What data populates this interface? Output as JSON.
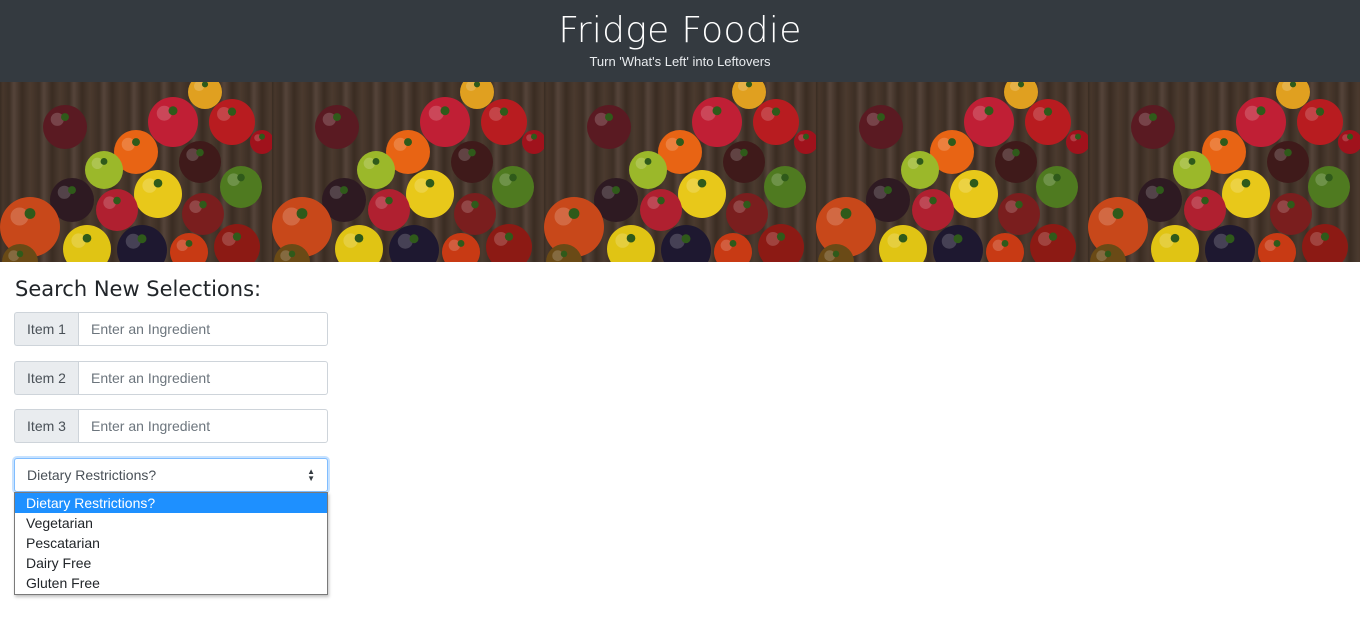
{
  "header": {
    "title": "Fridge Foodie",
    "tagline": "Turn 'What's Left' into Leftovers"
  },
  "search": {
    "heading": "Search New Selections:",
    "items": [
      {
        "label": "Item 1",
        "placeholder": "Enter an Ingredient"
      },
      {
        "label": "Item 2",
        "placeholder": "Enter an Ingredient"
      },
      {
        "label": "Item 3",
        "placeholder": "Enter an Ingredient"
      }
    ]
  },
  "dietary": {
    "selected": "Dietary Restrictions?",
    "options": [
      "Dietary Restrictions?",
      "Vegetarian",
      "Pescatarian",
      "Dairy Free",
      "Gluten Free"
    ],
    "highlighted_index": 0
  },
  "colors": {
    "header_bg": "#343a40",
    "option_highlight": "#1e90ff",
    "input_focus": "#80bdff"
  }
}
